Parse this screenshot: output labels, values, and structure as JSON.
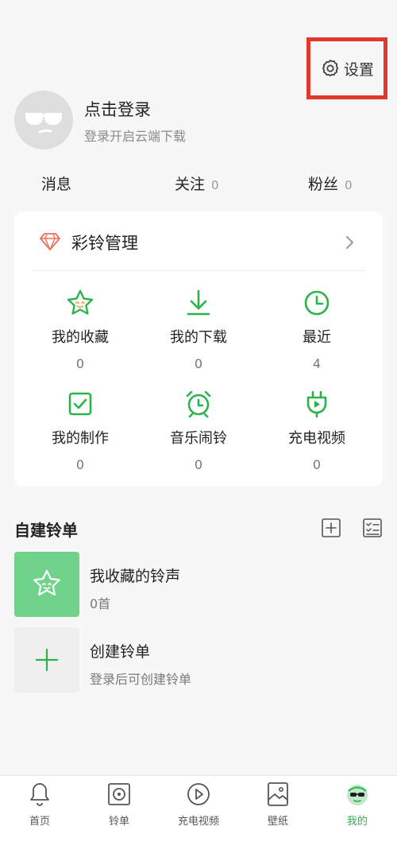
{
  "header": {
    "settings_label": "设置"
  },
  "profile": {
    "title": "点击登录",
    "subtitle": "登录开启云端下载"
  },
  "stats": [
    {
      "label": "消息",
      "count": ""
    },
    {
      "label": "关注",
      "count": "0"
    },
    {
      "label": "粉丝",
      "count": "0"
    }
  ],
  "ringtone_card": {
    "title": "彩铃管理",
    "items": [
      {
        "label": "我的收藏",
        "count": "0",
        "icon": "star-icon"
      },
      {
        "label": "我的下载",
        "count": "0",
        "icon": "download-icon"
      },
      {
        "label": "最近",
        "count": "4",
        "icon": "clock-icon"
      },
      {
        "label": "我的制作",
        "count": "0",
        "icon": "check-box-icon"
      },
      {
        "label": "音乐闹铃",
        "count": "0",
        "icon": "alarm-clock-icon"
      },
      {
        "label": "充电视频",
        "count": "0",
        "icon": "charging-plug-icon"
      }
    ]
  },
  "playlists": {
    "title": "自建铃单",
    "items": [
      {
        "title": "我收藏的铃声",
        "subtitle": "0首"
      },
      {
        "title": "创建铃单",
        "subtitle": "登录后可创建铃单"
      }
    ]
  },
  "nav": {
    "tabs": [
      {
        "label": "首页",
        "icon": "bell-icon"
      },
      {
        "label": "铃单",
        "icon": "disc-icon"
      },
      {
        "label": "充电视频",
        "icon": "play-circle-icon"
      },
      {
        "label": "壁纸",
        "icon": "wallpaper-icon"
      },
      {
        "label": "我的",
        "icon": "profile-face-icon"
      }
    ],
    "active_index": 4
  },
  "colors": {
    "accent": "#2bb24c",
    "highlight_border": "#e0392f",
    "gem": "#e8735a"
  }
}
